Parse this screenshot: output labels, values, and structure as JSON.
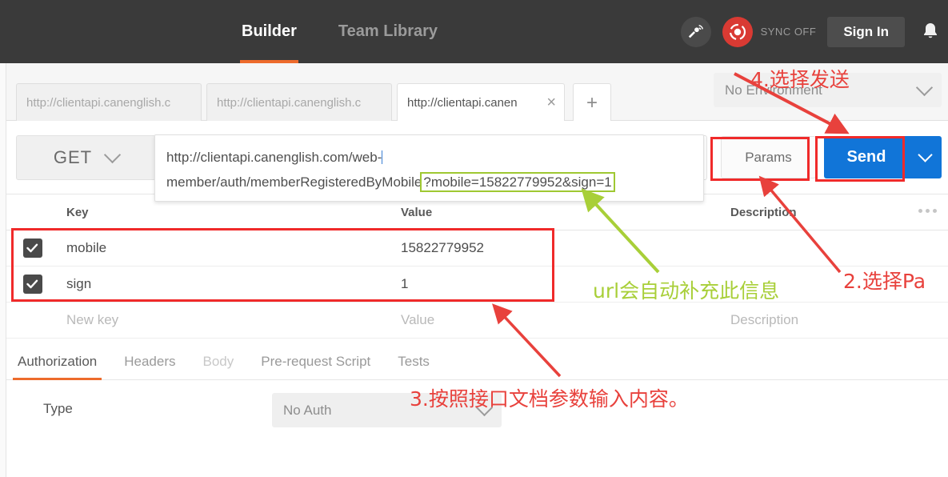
{
  "header": {
    "nav": [
      {
        "label": "Builder",
        "active": true
      },
      {
        "label": "Team Library",
        "active": false
      }
    ],
    "satellite_icon": "satellite-dish-icon",
    "sync_icon": "sync-status-icon",
    "sync_label": "SYNC OFF",
    "signin_label": "Sign In",
    "bell_icon": "bell-icon",
    "accent_color": "#ed6b2c",
    "background_color": "#3a3a3a"
  },
  "tabs": {
    "items": [
      {
        "label": "http://clientapi.canenglish.c",
        "active": false
      },
      {
        "label": "http://clientapi.canenglish.c",
        "active": false
      },
      {
        "label": "http://clientapi.canen",
        "active": true
      }
    ],
    "close_glyph": "×",
    "add_glyph": "+"
  },
  "environment": {
    "selected": "No Environment"
  },
  "request": {
    "method": "GET",
    "url_line1": "http://clientapi.canenglish.com/web-",
    "url_line2": "member/auth/memberRegisteredByMobile",
    "url_query": "?mobile=15822779952&sign=1",
    "full_url": "http://clientapi.canenglish.com/web-member/auth/memberRegisteredByMobile?mobile=15822779952&sign=1",
    "params_label": "Params",
    "send_label": "Send",
    "send_color": "#1175d8"
  },
  "params": {
    "columns": [
      "Key",
      "Value",
      "Description"
    ],
    "rows": [
      {
        "checked": true,
        "key": "mobile",
        "value": "15822779952",
        "description": ""
      },
      {
        "checked": true,
        "key": "sign",
        "value": "1",
        "description": ""
      }
    ],
    "new_row": {
      "key": "New key",
      "value": "Value",
      "description": "Description"
    }
  },
  "lower_tabs": [
    {
      "label": "Authorization",
      "active": true,
      "dim": false
    },
    {
      "label": "Headers",
      "active": false,
      "dim": false
    },
    {
      "label": "Body",
      "active": false,
      "dim": true
    },
    {
      "label": "Pre-request Script",
      "active": false,
      "dim": false
    },
    {
      "label": "Tests",
      "active": false,
      "dim": false
    }
  ],
  "auth": {
    "type_label": "Type",
    "type_value": "No Auth"
  },
  "annotations": {
    "step4": "4.选择发送",
    "step2": "2.选择Pa",
    "step3": "3.按照接口文档参数输入内容。",
    "green": "url会自动补充此信息",
    "red_color": "#e8413c",
    "green_color": "#a8cf38",
    "box_color": "#f02a2a"
  }
}
